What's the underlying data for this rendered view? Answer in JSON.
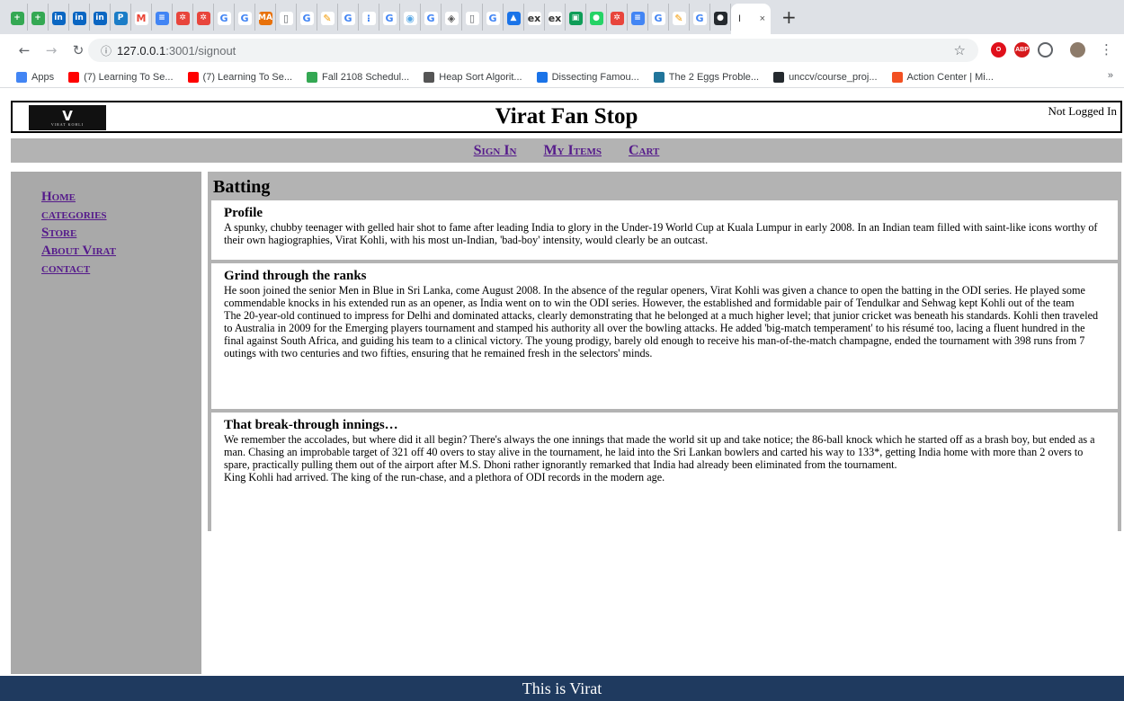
{
  "browser": {
    "tabs": [
      {
        "icon": "add-app-icon",
        "color": "#34a853",
        "glyph": "+"
      },
      {
        "icon": "add-app-icon",
        "color": "#34a853",
        "glyph": "+"
      },
      {
        "icon": "linkedin-icon",
        "color": "#0a66c2",
        "glyph": "in"
      },
      {
        "icon": "linkedin-icon",
        "color": "#0a66c2",
        "glyph": "in"
      },
      {
        "icon": "linkedin-icon",
        "color": "#0a66c2",
        "glyph": "in"
      },
      {
        "icon": "pocket-icon",
        "color": "#1b7dc7",
        "glyph": "P"
      },
      {
        "icon": "gmail-icon",
        "color": "#ffffff",
        "glyph": "M",
        "fg": "#ea4335"
      },
      {
        "icon": "docs-icon",
        "color": "#4285f4",
        "glyph": "≡"
      },
      {
        "icon": "asterisk-icon",
        "color": "#e8453c",
        "glyph": "✲"
      },
      {
        "icon": "asterisk-icon",
        "color": "#e8453c",
        "glyph": "✲"
      },
      {
        "icon": "google-icon",
        "color": "#ffffff",
        "glyph": "G",
        "fg": "#4285f4"
      },
      {
        "icon": "google-icon",
        "color": "#ffffff",
        "glyph": "G",
        "fg": "#4285f4"
      },
      {
        "icon": "ma-icon",
        "color": "#e8710a",
        "glyph": "MA"
      },
      {
        "icon": "page-icon",
        "color": "#ffffff",
        "glyph": "▯",
        "fg": "#5f6368"
      },
      {
        "icon": "google-icon",
        "color": "#ffffff",
        "glyph": "G",
        "fg": "#4285f4"
      },
      {
        "icon": "pencil-icon",
        "color": "#ffffff",
        "glyph": "✎",
        "fg": "#f29900"
      },
      {
        "icon": "google-icon",
        "color": "#ffffff",
        "glyph": "G",
        "fg": "#4285f4"
      },
      {
        "icon": "grid-icon",
        "color": "#ffffff",
        "glyph": "⁝",
        "fg": "#4285f4"
      },
      {
        "icon": "google-icon",
        "color": "#ffffff",
        "glyph": "G",
        "fg": "#4285f4"
      },
      {
        "icon": "eye-icon",
        "color": "#ffffff",
        "glyph": "◉",
        "fg": "#5aa9e6"
      },
      {
        "icon": "google-icon",
        "color": "#ffffff",
        "glyph": "G",
        "fg": "#4285f4"
      },
      {
        "icon": "diamond-icon",
        "color": "#ffffff",
        "glyph": "◈",
        "fg": "#555"
      },
      {
        "icon": "page-icon",
        "color": "#ffffff",
        "glyph": "▯",
        "fg": "#5f6368"
      },
      {
        "icon": "google-icon",
        "color": "#ffffff",
        "glyph": "G",
        "fg": "#4285f4"
      },
      {
        "icon": "hat-icon",
        "color": "#1a73e8",
        "glyph": "▲"
      },
      {
        "icon": "ex-icon",
        "color": "#ffffff",
        "glyph": "ex",
        "fg": "#333"
      },
      {
        "icon": "ex-icon",
        "color": "#ffffff",
        "glyph": "ex",
        "fg": "#333"
      },
      {
        "icon": "hangouts-icon",
        "color": "#0f9d58",
        "glyph": "▣"
      },
      {
        "icon": "whatsapp-icon",
        "color": "#25d366",
        "glyph": "●"
      },
      {
        "icon": "asterisk-icon",
        "color": "#e8453c",
        "glyph": "✲"
      },
      {
        "icon": "docs-icon",
        "color": "#4285f4",
        "glyph": "≡"
      },
      {
        "icon": "google-icon",
        "color": "#ffffff",
        "glyph": "G",
        "fg": "#4285f4"
      },
      {
        "icon": "pencil-icon",
        "color": "#ffffff",
        "glyph": "✎",
        "fg": "#f29900"
      },
      {
        "icon": "google-icon",
        "color": "#ffffff",
        "glyph": "G",
        "fg": "#4285f4"
      },
      {
        "icon": "github-icon",
        "color": "#24292e",
        "glyph": "●"
      }
    ],
    "active_tab_title": "I",
    "active_tab_close": "×",
    "new_tab": "+",
    "url_host": "127.0.0.1",
    "url_path": ":3001/signout",
    "bookmarks": [
      {
        "label": "Apps",
        "color": "#4285f4"
      },
      {
        "label": "(7) Learning To Se...",
        "color": "#ff0000"
      },
      {
        "label": "(7) Learning To Se...",
        "color": "#ff0000"
      },
      {
        "label": "Fall 2108 Schedul...",
        "color": "#34a853"
      },
      {
        "label": "Heap Sort Algorit...",
        "color": "#555555"
      },
      {
        "label": "Dissecting Famou...",
        "color": "#1a73e8"
      },
      {
        "label": "The 2 Eggs Proble...",
        "color": "#21759b"
      },
      {
        "label": "unccv/course_proj...",
        "color": "#24292e"
      },
      {
        "label": "Action Center | Mi...",
        "color": "#f25022"
      }
    ],
    "bookmarks_more": "»"
  },
  "site": {
    "logo_mark": "V",
    "logo_text": "VIRAT KOHLI",
    "title": "Virat Fan Stop",
    "login_status": "Not Logged In"
  },
  "topnav": [
    "Sign In",
    "My Items",
    "Cart"
  ],
  "sidenav": [
    "Home",
    "categories",
    "Store",
    "About Virat",
    "contact"
  ],
  "main": {
    "heading": "Batting",
    "sections": [
      {
        "title": "Profile",
        "paragraphs": [
          "A spunky, chubby teenager with gelled hair shot to fame after leading India to glory in the Under-19 World Cup at Kuala Lumpur in early 2008. In an Indian team filled with saint-like icons worthy of their own hagiographies, Virat Kohli, with his most un-Indian, 'bad-boy' intensity, would clearly be an outcast."
        ]
      },
      {
        "title": "Grind through the ranks",
        "paragraphs": [
          "He soon joined the senior Men in Blue in Sri Lanka, come August 2008. In the absence of the regular openers, Virat Kohli was given a chance to open the batting in the ODI series. He played some commendable knocks in his extended run as an opener, as India went on to win the ODI series. However, the established and formidable pair of Tendulkar and Sehwag kept Kohli out of the team",
          "The 20-year-old continued to impress for Delhi and dominated attacks, clearly demonstrating that he belonged at a much higher level; that junior cricket was beneath his standards. Kohli then traveled to Australia in 2009 for the Emerging players tournament and stamped his authority all over the bowling attacks. He added 'big-match temperament' to his résumé too, lacing a fluent hundred in the final against South Africa, and guiding his team to a clinical victory. The young prodigy, barely old enough to receive his man-of-the-match champagne, ended the tournament with 398 runs from 7 outings with two centuries and two fifties, ensuring that he remained fresh in the selectors' minds."
        ]
      },
      {
        "title": "That break-through innings…",
        "paragraphs": [
          "We remember the accolades, but where did it all begin? There's always the one innings that made the world sit up and take notice; the 86-ball knock which he started off as a brash boy, but ended as a man. Chasing an improbable target of 321 off 40 overs to stay alive in the tournament, he laid into the Sri Lankan bowlers and carted his way to 133*, getting India home with more than 2 overs to spare, practically pulling them out of the airport after M.S. Dhoni rather ignorantly remarked that India had already been eliminated from the tournament.",
          "King Kohli had arrived. The king of the run-chase, and a plethora of ODI records in the modern age."
        ]
      }
    ]
  },
  "footer": "This is Virat"
}
